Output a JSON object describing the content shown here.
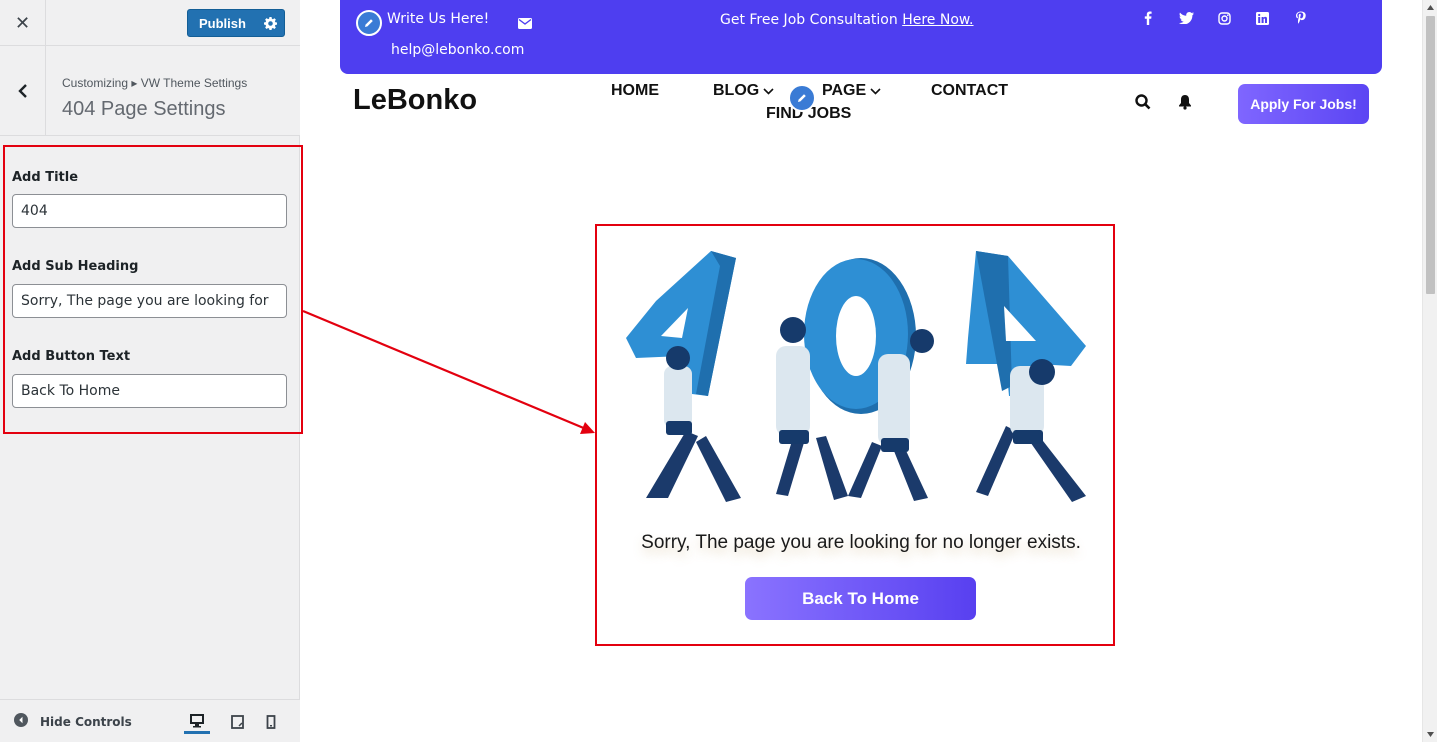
{
  "sidebar": {
    "close_icon": "close-icon",
    "publish_label": "Publish",
    "publish_icon": "gear-icon",
    "back_icon": "chevron-left-icon",
    "breadcrumb": "Customizing ▸ VW Theme Settings",
    "section_title": "404 Page Settings",
    "controls": [
      {
        "label": "Add Title",
        "value": "404"
      },
      {
        "label": "Add Sub Heading",
        "value": "Sorry, The page you are looking for"
      },
      {
        "label": "Add Button Text",
        "value": "Back To Home"
      }
    ],
    "footer": {
      "hide_controls_label": "Hide Controls",
      "devices": [
        "desktop-icon",
        "tablet-icon",
        "mobile-icon"
      ],
      "active_device": "desktop"
    }
  },
  "preview": {
    "topbar": {
      "write_us": "Write Us Here!",
      "email": "help@lebonko.com",
      "consult_text": "Get Free Job Consultation",
      "consult_link": "Here Now.",
      "social": [
        "facebook-icon",
        "twitter-icon",
        "instagram-icon",
        "linkedin-icon",
        "pinterest-icon"
      ],
      "background": "#4e3ef0"
    },
    "header": {
      "logo": "LeBonko",
      "nav": [
        {
          "label": "HOME",
          "dropdown": false
        },
        {
          "label": "BLOG",
          "dropdown": true
        },
        {
          "label": "PAGE",
          "dropdown": true
        },
        {
          "label": "CONTACT",
          "dropdown": false
        },
        {
          "label": "FIND JOBS",
          "dropdown": false
        }
      ],
      "apply_button": "Apply For Jobs!"
    },
    "error_page": {
      "title": "404",
      "sub_heading": "Sorry, The page you are looking for no longer exists.",
      "button": "Back To Home"
    }
  },
  "colors": {
    "accent": "#2271b1",
    "brand": "#5b45f3",
    "annotation": "#e3000f"
  }
}
